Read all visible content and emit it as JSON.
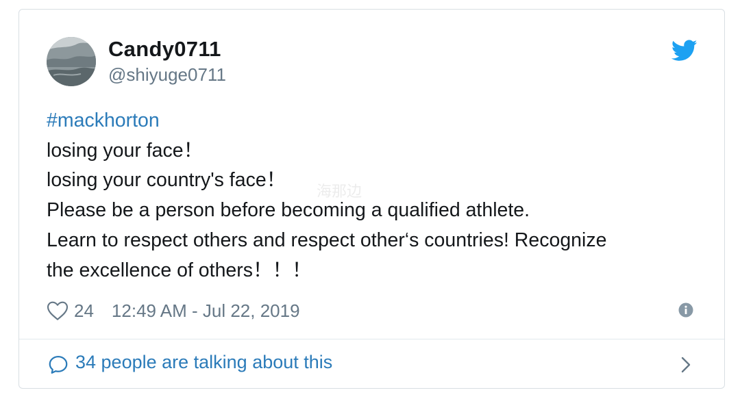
{
  "user": {
    "name": "Candy0711",
    "handle": "@shiyuge0711"
  },
  "tweet": {
    "hashtag": "#mackhorton",
    "lines": [
      "losing your face！",
      "losing your country's face！",
      "Please be a person before becoming a qualified athlete.",
      "Learn to respect others and respect other‘s countries! Recognize",
      "the excellence of others！！！"
    ]
  },
  "meta": {
    "like_count": "24",
    "timestamp": "12:49 AM - Jul 22, 2019"
  },
  "conversation": {
    "label": "34 people are talking about this"
  },
  "icons": {
    "brand": "twitter-bird-icon",
    "like": "heart-icon",
    "info": "info-icon",
    "reply": "speech-bubble-icon",
    "more": "chevron-right-icon"
  },
  "colors": {
    "brand_blue": "#1da1f2",
    "link_blue": "#2b7bb9",
    "text": "#14171a",
    "muted": "#657786",
    "border": "#e1e8ed"
  },
  "watermark": "海那边"
}
